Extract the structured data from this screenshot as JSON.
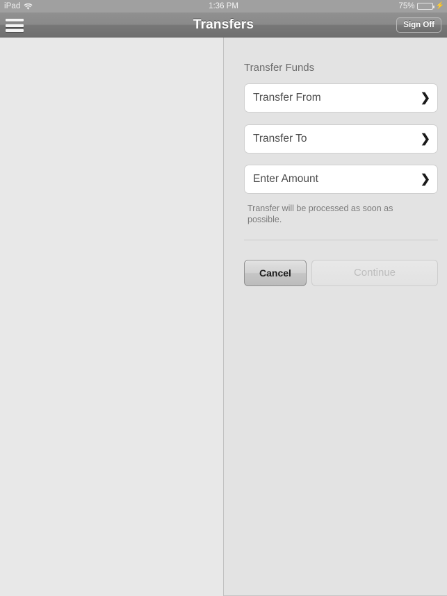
{
  "status_bar": {
    "carrier": "iPad",
    "wifi_icon": "wifi-icon",
    "time": "1:36 PM",
    "battery_percent": "75%",
    "battery_level": 75,
    "charging_icon": "lightning-bolt-icon"
  },
  "nav_bar": {
    "menu_icon": "hamburger-menu-icon",
    "title": "Transfers",
    "sign_off_label": "Sign Off"
  },
  "form": {
    "section_title": "Transfer Funds",
    "fields": [
      {
        "label": "Transfer From",
        "chevron": "❯"
      },
      {
        "label": "Transfer To",
        "chevron": "❯"
      },
      {
        "label": "Enter Amount",
        "chevron": "❯"
      }
    ],
    "helper_text": "Transfer will be processed as soon as possible.",
    "cancel_label": "Cancel",
    "continue_label": "Continue"
  },
  "colors": {
    "status_bar_bg": "#a0a0a0",
    "nav_bar_bg": "#7f7f7f",
    "left_pane_bg": "#e8e8e8",
    "right_pane_bg": "#e3e3e3",
    "field_bg": "#ffffff",
    "battery_green": "#44dd55",
    "label_text": "#4c4c4c",
    "helper_text": "#7b7b7b"
  }
}
